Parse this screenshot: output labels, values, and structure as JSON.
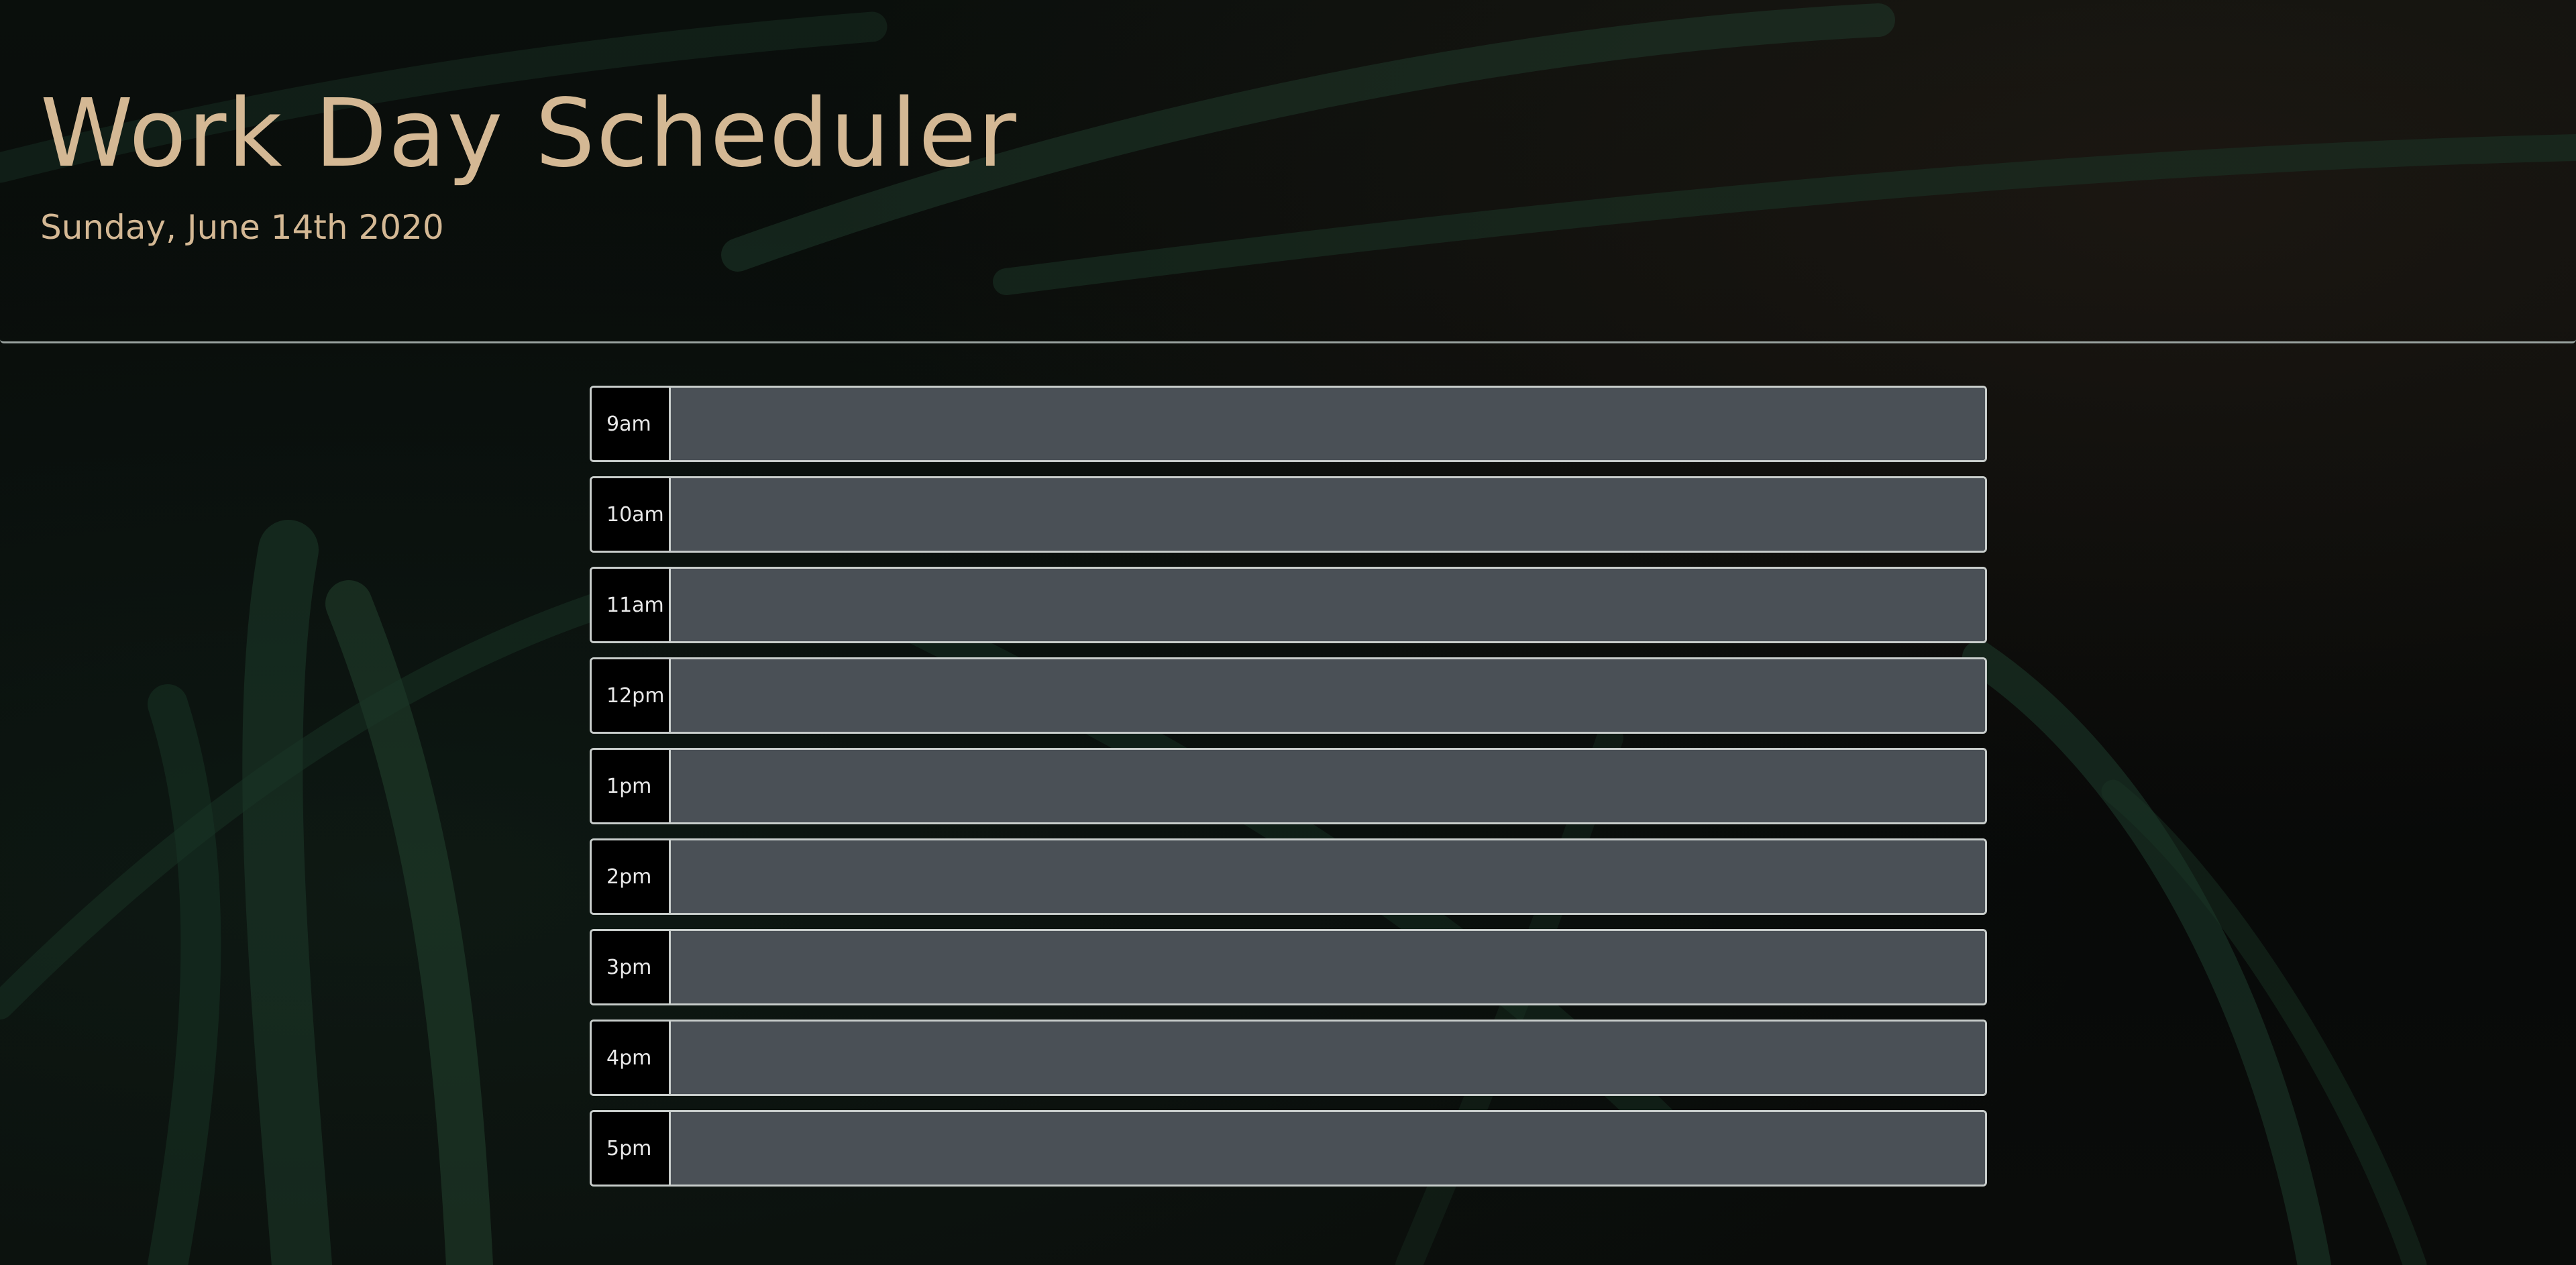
{
  "header": {
    "title": "Work Day Scheduler",
    "date": "Sunday, June 14th 2020"
  },
  "colors": {
    "title": "#d4b894",
    "textarea_bg": "#4a5056",
    "border": "#c8cdcb"
  },
  "rows": [
    {
      "hour": "9am",
      "text": ""
    },
    {
      "hour": "10am",
      "text": ""
    },
    {
      "hour": "11am",
      "text": ""
    },
    {
      "hour": "12pm",
      "text": ""
    },
    {
      "hour": "1pm",
      "text": ""
    },
    {
      "hour": "2pm",
      "text": ""
    },
    {
      "hour": "3pm",
      "text": ""
    },
    {
      "hour": "4pm",
      "text": ""
    },
    {
      "hour": "5pm",
      "text": ""
    }
  ]
}
